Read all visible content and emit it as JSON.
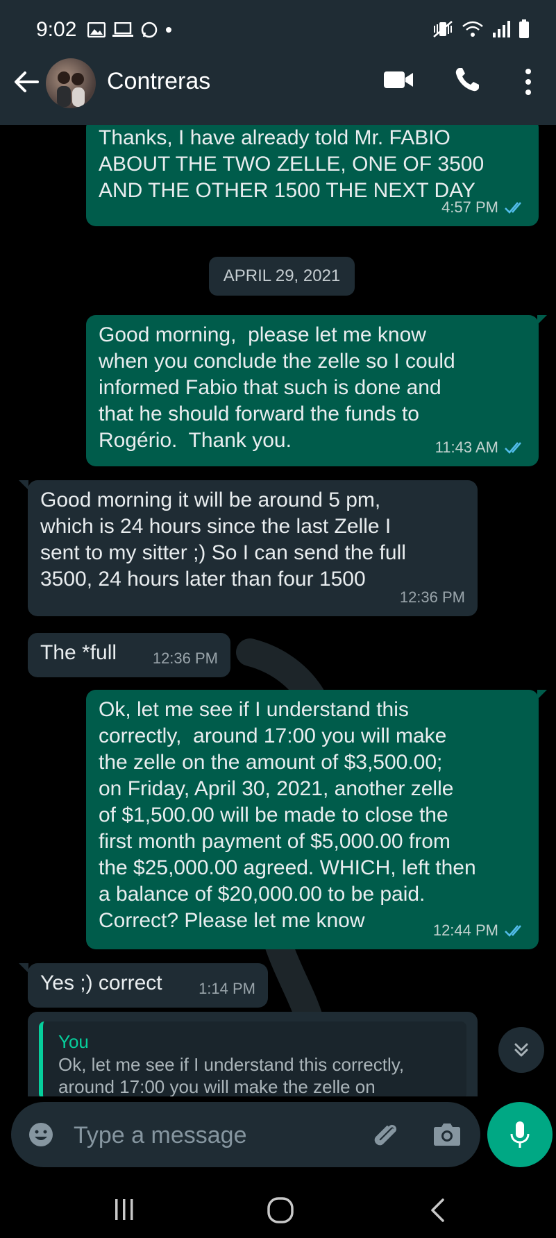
{
  "status_bar": {
    "time": "9:02"
  },
  "header": {
    "contact_name": "Contreras"
  },
  "date_chip": "APRIL 29, 2021",
  "messages": [
    {
      "dir": "out",
      "text": "Thanks, I have already told Mr. FABIO\nABOUT THE TWO ZELLE, ONE OF 3500\nAND THE OTHER 1500 THE NEXT DAY",
      "time": "4:57 PM"
    },
    {
      "dir": "out",
      "text": "Good morning,  please let me know\nwhen you conclude the zelle so I could\ninformed Fabio that such is done and\nthat he should forward the funds to\nRogério.  Thank you.",
      "time": "11:43 AM"
    },
    {
      "dir": "in",
      "text": "Good morning it will be around 5 pm,\nwhich is 24 hours since the last Zelle I\nsent to my sitter ;) So I can send the full\n3500, 24 hours later than four 1500",
      "time": "12:36 PM"
    },
    {
      "dir": "in",
      "text": "The *full",
      "time": "12:36 PM"
    },
    {
      "dir": "out",
      "text": "Ok, let me see if I understand this\ncorrectly,  around 17:00 you will make\nthe zelle on the amount of $3,500.00;\non Friday, April 30, 2021, another zelle\nof $1,500.00 will be made to close the\nfirst month payment of $5,000.00 from\nthe $25,000.00 agreed. WHICH, left then\na balance of $20,000.00 to be paid.\nCorrect? Please let me know",
      "time": "12:44 PM"
    },
    {
      "dir": "in",
      "text": "Yes ;) correct",
      "time": "1:14 PM"
    }
  ],
  "reply_preview": {
    "author": "You",
    "text": "Ok, let me see if I understand this correctly,\naround 17:00 you will make the zelle on"
  },
  "composer": {
    "placeholder": "Type a message"
  },
  "colors": {
    "outgoing_bubble": "#005c4b",
    "incoming_bubble": "#1f2c34",
    "accent": "#00a884",
    "read_ticks": "#53bdeb"
  }
}
